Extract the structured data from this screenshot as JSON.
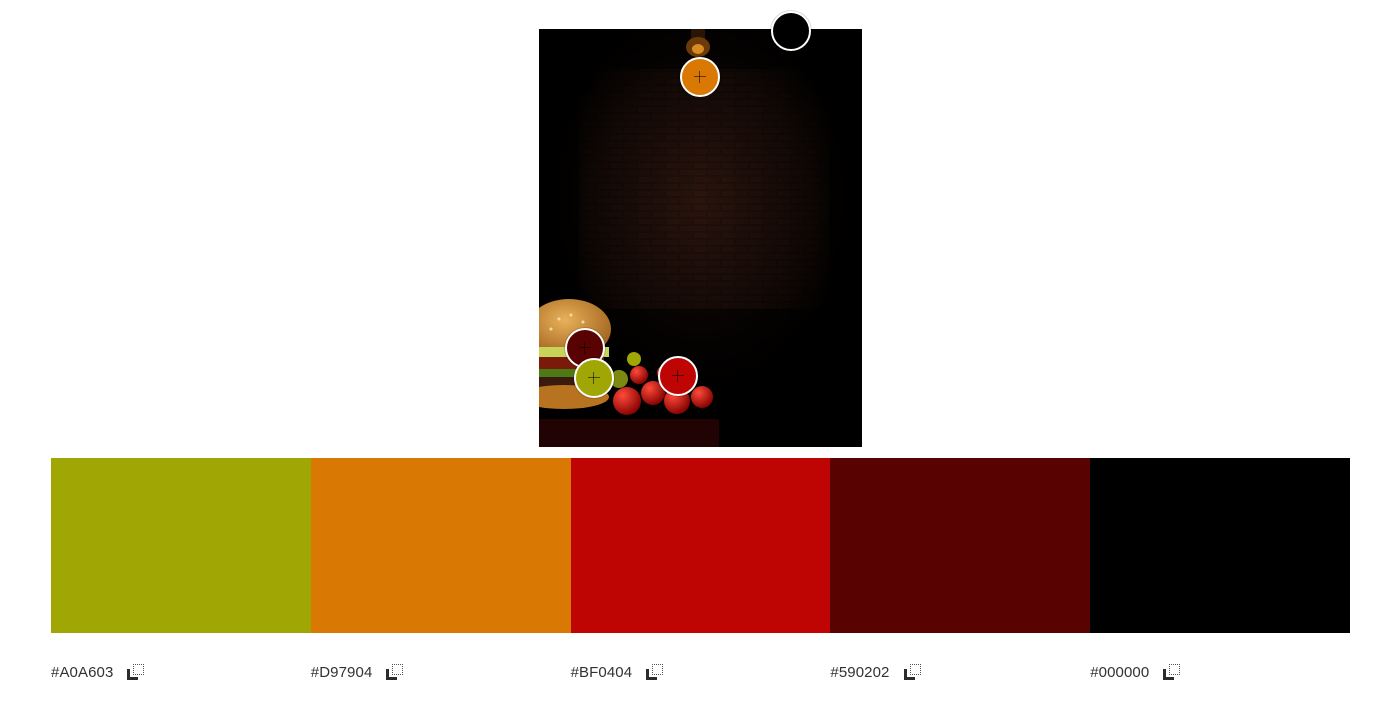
{
  "palette": {
    "colors": [
      {
        "name": "swatch-1",
        "hex": "#A0A603",
        "label": "#A0A603"
      },
      {
        "name": "swatch-2",
        "hex": "#D97904",
        "label": "#D97904"
      },
      {
        "name": "swatch-3",
        "hex": "#BF0404",
        "label": "#BF0404"
      },
      {
        "name": "swatch-4",
        "hex": "#590202",
        "label": "#590202"
      },
      {
        "name": "swatch-5",
        "hex": "#000000",
        "label": "#000000"
      }
    ]
  },
  "icons": {
    "copy": "copy-icon",
    "marker_crosshair": "crosshair-icon"
  }
}
